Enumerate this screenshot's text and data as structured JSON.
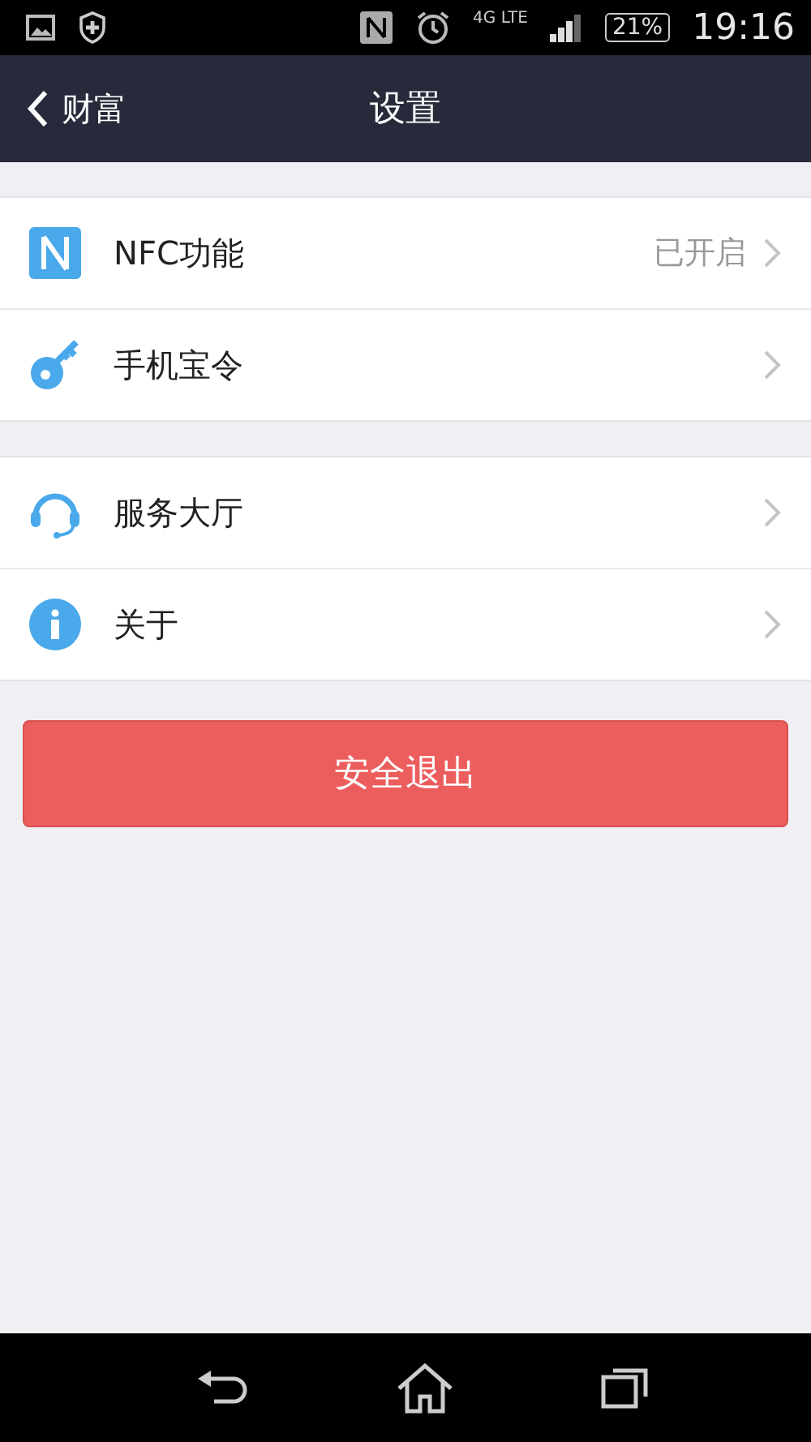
{
  "status_bar": {
    "network": "4G LTE",
    "battery": "21%",
    "time": "19:16"
  },
  "header": {
    "back_label": "财富",
    "title": "设置"
  },
  "groups": [
    {
      "items": [
        {
          "kind": "nfc",
          "label": "NFC功能",
          "value": "已开启"
        },
        {
          "kind": "key",
          "label": "手机宝令"
        }
      ]
    },
    {
      "items": [
        {
          "kind": "headset",
          "label": "服务大厅"
        },
        {
          "kind": "info",
          "label": "关于"
        }
      ]
    }
  ],
  "logout_button": "安全退出"
}
